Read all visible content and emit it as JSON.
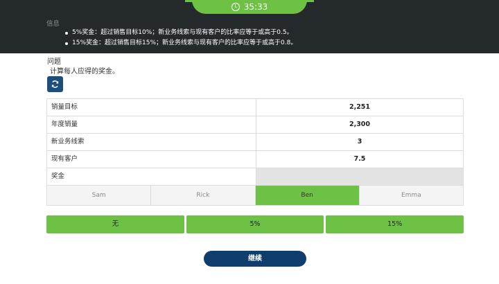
{
  "header": {
    "timer": "35:33",
    "info_label": "信息",
    "info_items": [
      "5%奖金：超过销售目标10%；新业务线索与现有客户的比率应等于或高于0.5。",
      "15%奖金：超过销售目标15%；新业务线索与现有客户的比率应等于或高于0.8。"
    ]
  },
  "question": {
    "label": "问题",
    "text": "计算每人应得的奖金。"
  },
  "table": {
    "rows": [
      {
        "label": "销量目标",
        "value": "2,251"
      },
      {
        "label": "年度销量",
        "value": "2,300"
      },
      {
        "label": "新业务线索",
        "value": "3"
      },
      {
        "label": "现有客户",
        "value": "7.5"
      },
      {
        "label": "奖金",
        "value": ""
      }
    ],
    "people": [
      "Sam",
      "Rick",
      "Ben",
      "Emma"
    ],
    "selected_person": "Ben"
  },
  "options": [
    "无",
    "5%",
    "15%"
  ],
  "continue_label": "继续",
  "colors": {
    "header_bg": "#24292c",
    "accent_green": "#6dc245",
    "primary_blue": "#0f3e6c"
  },
  "icons": {
    "timer": "clock-icon",
    "refresh": "refresh-icon"
  }
}
